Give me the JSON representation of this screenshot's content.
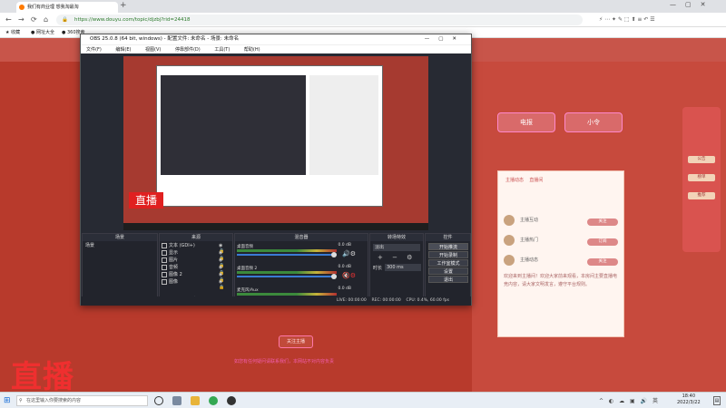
{
  "browser": {
    "tab_title": "我们有商业理 想我淘最淘",
    "url": "https://www.douyu.com/topic/djzbj?rid=24418",
    "bookmarks": [
      "收藏",
      "网址大全",
      "360搜索"
    ]
  },
  "site": {
    "buttons": [
      "电报",
      "小令"
    ],
    "side_items": [
      "公告",
      "榜单",
      "推荐"
    ],
    "panel": {
      "tabs": [
        "主播动态",
        "直播间"
      ],
      "rows": [
        {
          "name": "主播互动",
          "tag": "关注"
        },
        {
          "name": "主播热门",
          "tag": "订阅"
        },
        {
          "name": "主播动态",
          "tag": "关注"
        }
      ],
      "note": "欢迎来到主播间！欢迎大家前来观看，本房间主要直播电竞内容，请大家文明发言，遵守平台规则。"
    },
    "follow_button": "关注主播",
    "footer_text": "如您有任何疑问请联系我们，本网站不对内容负责",
    "logo_text": "直播"
  },
  "obs": {
    "title": "OBS 25.0.8 (64 bit, windows) - 配置文件: 未命名 - 场景: 未命名",
    "menu": [
      "文件(F)",
      "编辑(E)",
      "视图(V)",
      "停靠部件(D)",
      "工具(T)",
      "帮助(H)"
    ],
    "docks": {
      "scenes": {
        "title": "场景",
        "item": "场景"
      },
      "sources": {
        "title": "来源",
        "items": [
          "文本 (GDI+)",
          "显示",
          "图片",
          "音频",
          "图像 2",
          "图像"
        ]
      },
      "mixer": {
        "title": "混音器",
        "channels": [
          {
            "name": "桌面音频",
            "db": "0.0 dB"
          },
          {
            "name": "桌面音频 2",
            "db": "0.0 dB"
          },
          {
            "name": "麦克风/Aux",
            "db": "0.0 dB"
          }
        ]
      },
      "transitions": {
        "title": "转场特效",
        "type": "淡出",
        "duration_label": "时长",
        "duration": "300 ms"
      },
      "controls": {
        "title": "控件",
        "buttons": [
          "开始推流",
          "开始录制",
          "工作室模式",
          "设置",
          "退出"
        ]
      }
    },
    "status": {
      "live": "LIVE: 00:00:00",
      "rec": "REC: 00:00:00",
      "cpu": "CPU: 0.4%, 60.00 fps"
    }
  },
  "taskbar": {
    "search_placeholder": "在这里输入你要搜索的内容",
    "time": "18:40",
    "date": "2022/3/22"
  }
}
